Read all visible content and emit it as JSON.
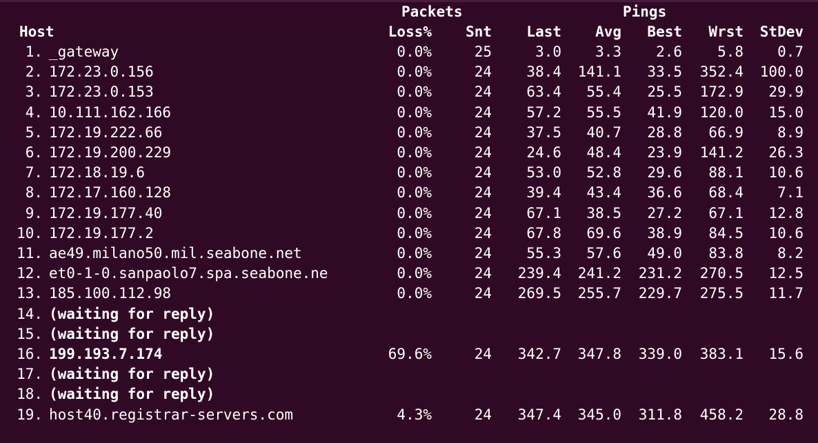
{
  "header": {
    "group_packets": "Packets",
    "group_pings": "Pings",
    "col_host": "Host",
    "col_loss": "Loss%",
    "col_snt": "Snt",
    "col_last": "Last",
    "col_avg": "Avg",
    "col_best": "Best",
    "col_wrst": "Wrst",
    "col_stdev": "StDev"
  },
  "rows": [
    {
      "num": "1.",
      "host": "_gateway",
      "loss": "0.0%",
      "snt": "25",
      "last": "3.0",
      "avg": "3.3",
      "best": "2.6",
      "wrst": "5.8",
      "stdev": "0.7",
      "bold": false
    },
    {
      "num": "2.",
      "host": "172.23.0.156",
      "loss": "0.0%",
      "snt": "24",
      "last": "38.4",
      "avg": "141.1",
      "best": "33.5",
      "wrst": "352.4",
      "stdev": "100.0",
      "bold": false
    },
    {
      "num": "3.",
      "host": "172.23.0.153",
      "loss": "0.0%",
      "snt": "24",
      "last": "63.4",
      "avg": "55.4",
      "best": "25.5",
      "wrst": "172.9",
      "stdev": "29.9",
      "bold": false
    },
    {
      "num": "4.",
      "host": "10.111.162.166",
      "loss": "0.0%",
      "snt": "24",
      "last": "57.2",
      "avg": "55.5",
      "best": "41.9",
      "wrst": "120.0",
      "stdev": "15.0",
      "bold": false
    },
    {
      "num": "5.",
      "host": "172.19.222.66",
      "loss": "0.0%",
      "snt": "24",
      "last": "37.5",
      "avg": "40.7",
      "best": "28.8",
      "wrst": "66.9",
      "stdev": "8.9",
      "bold": false
    },
    {
      "num": "6.",
      "host": "172.19.200.229",
      "loss": "0.0%",
      "snt": "24",
      "last": "24.6",
      "avg": "48.4",
      "best": "23.9",
      "wrst": "141.2",
      "stdev": "26.3",
      "bold": false
    },
    {
      "num": "7.",
      "host": "172.18.19.6",
      "loss": "0.0%",
      "snt": "24",
      "last": "53.0",
      "avg": "52.8",
      "best": "29.6",
      "wrst": "88.1",
      "stdev": "10.6",
      "bold": false
    },
    {
      "num": "8.",
      "host": "172.17.160.128",
      "loss": "0.0%",
      "snt": "24",
      "last": "39.4",
      "avg": "43.4",
      "best": "36.6",
      "wrst": "68.4",
      "stdev": "7.1",
      "bold": false
    },
    {
      "num": "9.",
      "host": "172.19.177.40",
      "loss": "0.0%",
      "snt": "24",
      "last": "67.1",
      "avg": "38.5",
      "best": "27.2",
      "wrst": "67.1",
      "stdev": "12.8",
      "bold": false
    },
    {
      "num": "10.",
      "host": "172.19.177.2",
      "loss": "0.0%",
      "snt": "24",
      "last": "67.8",
      "avg": "69.6",
      "best": "38.9",
      "wrst": "84.5",
      "stdev": "10.6",
      "bold": false
    },
    {
      "num": "11.",
      "host": "ae49.milano50.mil.seabone.net",
      "loss": "0.0%",
      "snt": "24",
      "last": "55.3",
      "avg": "57.6",
      "best": "49.0",
      "wrst": "83.8",
      "stdev": "8.2",
      "bold": false
    },
    {
      "num": "12.",
      "host": "et0-1-0.sanpaolo7.spa.seabone.ne",
      "loss": "0.0%",
      "snt": "24",
      "last": "239.4",
      "avg": "241.2",
      "best": "231.2",
      "wrst": "270.5",
      "stdev": "12.5",
      "bold": false
    },
    {
      "num": "13.",
      "host": "185.100.112.98",
      "loss": "0.0%",
      "snt": "24",
      "last": "269.5",
      "avg": "255.7",
      "best": "229.7",
      "wrst": "275.5",
      "stdev": "11.7",
      "bold": false
    },
    {
      "num": "14.",
      "host": "(waiting for reply)",
      "loss": "",
      "snt": "",
      "last": "",
      "avg": "",
      "best": "",
      "wrst": "",
      "stdev": "",
      "bold": true
    },
    {
      "num": "15.",
      "host": "(waiting for reply)",
      "loss": "",
      "snt": "",
      "last": "",
      "avg": "",
      "best": "",
      "wrst": "",
      "stdev": "",
      "bold": true
    },
    {
      "num": "16.",
      "host": "199.193.7.174",
      "loss": "69.6%",
      "snt": "24",
      "last": "342.7",
      "avg": "347.8",
      "best": "339.0",
      "wrst": "383.1",
      "stdev": "15.6",
      "bold": true
    },
    {
      "num": "17.",
      "host": "(waiting for reply)",
      "loss": "",
      "snt": "",
      "last": "",
      "avg": "",
      "best": "",
      "wrst": "",
      "stdev": "",
      "bold": true
    },
    {
      "num": "18.",
      "host": "(waiting for reply)",
      "loss": "",
      "snt": "",
      "last": "",
      "avg": "",
      "best": "",
      "wrst": "",
      "stdev": "",
      "bold": true
    },
    {
      "num": "19.",
      "host": "host40.registrar-servers.com",
      "loss": "4.3%",
      "snt": "24",
      "last": "347.4",
      "avg": "345.0",
      "best": "311.8",
      "wrst": "458.2",
      "stdev": "28.8",
      "bold": false
    }
  ],
  "colors": {
    "background": "#300a24",
    "text": "#ffffff"
  }
}
